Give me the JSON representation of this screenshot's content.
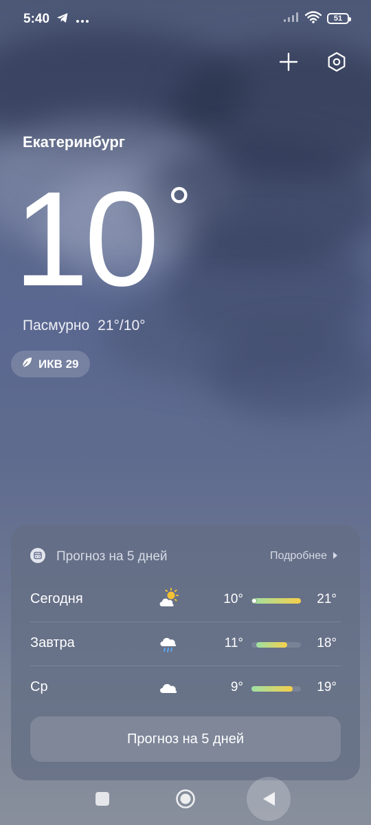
{
  "status": {
    "time": "5:40",
    "battery": "51"
  },
  "location": {
    "city": "Екатеринбург"
  },
  "current": {
    "temp": "10",
    "unit": "°",
    "condition": "Пасмурно",
    "range": "21°/10°"
  },
  "aqi": {
    "label": "ИКВ 29"
  },
  "forecast": {
    "title": "Прогноз на 5 дней",
    "more": "Подробнее",
    "button": "Прогноз на 5 дней",
    "days": [
      {
        "day": "Сегодня",
        "icon": "partly-cloudy-sun-icon",
        "low": "10°",
        "high": "21°",
        "bar_start": 0.0,
        "bar_end": 1.0,
        "current_marker": 0.0
      },
      {
        "day": "Завтра",
        "icon": "rain-cloud-icon",
        "low": "11°",
        "high": "18°",
        "bar_start": 0.1,
        "bar_end": 0.72
      },
      {
        "day": "Ср",
        "icon": "cloud-icon",
        "low": "9°",
        "high": "19°",
        "bar_start": 0.0,
        "bar_end": 0.84
      }
    ]
  },
  "colors": {
    "bar_start": "#9ee0a5",
    "bar_end": "#f5cf4a",
    "sun": "#f4c134",
    "rain": "#5da9f2"
  }
}
